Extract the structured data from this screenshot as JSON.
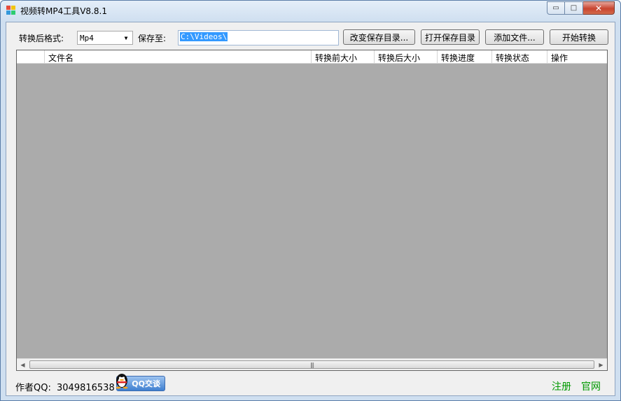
{
  "window": {
    "title": "视频转MP4工具V8.8.1",
    "caption_buttons": {
      "minimize": "▭",
      "maximize": "□",
      "close": "✕"
    }
  },
  "toolbar": {
    "format_label": "转换后格式:",
    "format_value": "Mp4",
    "save_to_label": "保存至:",
    "save_path": "C:\\Videos\\",
    "change_dir_button": "改变保存目录...",
    "open_dir_button": "打开保存目录",
    "add_files_button": "添加文件...",
    "start_button": "开始转换"
  },
  "table": {
    "columns": [
      "",
      "文件名",
      "转换前大小",
      "转换后大小",
      "转换进度",
      "转换状态",
      "操作"
    ],
    "rows": []
  },
  "footer": {
    "author_label": "作者QQ:",
    "author_qq": "3049816538",
    "qq_chat_button": "QQ交谈",
    "register_link": "注册",
    "website_link": "官网"
  },
  "colors": {
    "grid_background": "#ababab",
    "link_green": "#009900",
    "selection_blue": "#3399ff"
  }
}
